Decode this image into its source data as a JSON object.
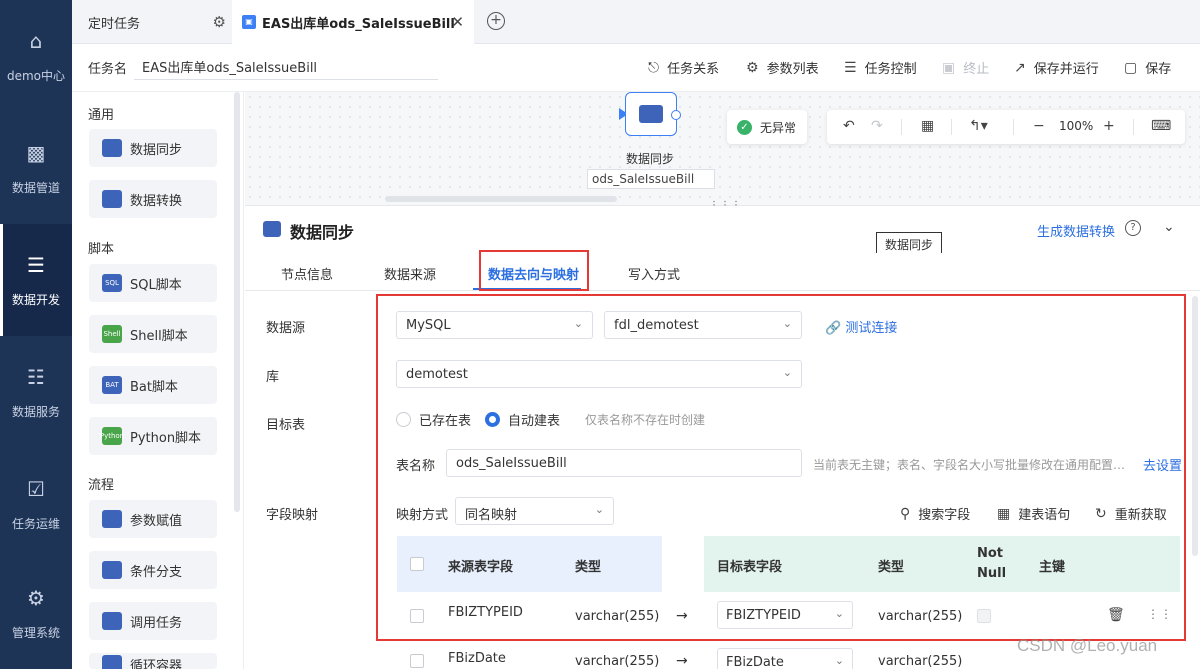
{
  "leftnav": {
    "items": [
      {
        "label": "demo中心",
        "icon": "home-icon"
      },
      {
        "label": "数据管道",
        "icon": "pipeline-icon"
      },
      {
        "label": "数据开发",
        "icon": "dev-icon",
        "active": true
      },
      {
        "label": "数据服务",
        "icon": "service-icon"
      },
      {
        "label": "任务运维",
        "icon": "ops-icon"
      },
      {
        "label": "管理系统",
        "icon": "settings-icon"
      }
    ]
  },
  "tabs": {
    "tab1": "定时任务",
    "tab2": "EAS出库单ods_SaleIssueBill"
  },
  "header": {
    "task_label": "任务名",
    "task_name": "EAS出库单ods_SaleIssueBill",
    "buttons": {
      "relation": "任务关系",
      "params": "参数列表",
      "control": "任务控制",
      "stop": "终止",
      "save_run": "保存并运行",
      "save": "保存"
    }
  },
  "sidebar": {
    "groups": {
      "general": "通用",
      "script": "脚本",
      "flow": "流程"
    },
    "items": {
      "sync": "数据同步",
      "transform": "数据转换",
      "sql": "SQL脚本",
      "shell": "Shell脚本",
      "bat": "Bat脚本",
      "python": "Python脚本",
      "assign": "参数赋值",
      "branch": "条件分支",
      "invoke": "调用任务",
      "loop": "循环容器"
    },
    "icon_text": {
      "sql": "SQL",
      "shell": "Shell",
      "bat": "BAT",
      "python": "Python"
    }
  },
  "canvas": {
    "node_label": "数据同步",
    "node_sub": "ods_SaleIssueBill",
    "status": "无异常",
    "zoom": "100%"
  },
  "section": {
    "title": "数据同步",
    "gen_link": "生成数据转换",
    "tooltip": "数据同步",
    "subtabs": [
      "节点信息",
      "数据来源",
      "数据去向与映射",
      "写入方式"
    ]
  },
  "form": {
    "datasource_label": "数据源",
    "datasource_type": "MySQL",
    "datasource_conn": "fdl_demotest",
    "test_link": "测试连接",
    "db_label": "库",
    "db_value": "demotest",
    "target_label": "目标表",
    "radio_existing": "已存在表",
    "radio_auto": "自动建表",
    "radio_hint": "仅表名称不存在时创建",
    "tablename_label": "表名称",
    "tablename_value": "ods_SaleIssueBill",
    "tablename_hint": "当前表无主键；表名、字段名大小写批量修改在通用配置…",
    "goto_settings": "去设置",
    "mapping_label": "字段映射",
    "mapping_mode_label": "映射方式",
    "mapping_mode": "同名映射",
    "actions": {
      "search": "搜索字段",
      "ddl": "建表语句",
      "refetch": "重新获取"
    }
  },
  "table": {
    "left_headers": {
      "field": "来源表字段",
      "type": "类型"
    },
    "right_headers": {
      "field": "目标表字段",
      "type": "类型",
      "notnull_1": "Not",
      "notnull_2": "Null",
      "pk": "主键"
    },
    "rows": [
      {
        "src": "FBIZTYPEID",
        "src_type": "varchar(255)",
        "dst": "FBIZTYPEID",
        "dst_type": "varchar(255)"
      },
      {
        "src": "FBizDate",
        "src_type": "varchar(255)",
        "dst": "FBizDate",
        "dst_type": "varchar(255)"
      }
    ],
    "arrow": "→"
  },
  "watermark": "CSDN @Leo.yuan",
  "colors": {
    "nav_bg": "#1e3456",
    "accent": "#2b6fe0",
    "highlight_red": "#e53935",
    "success": "#39b36a"
  }
}
